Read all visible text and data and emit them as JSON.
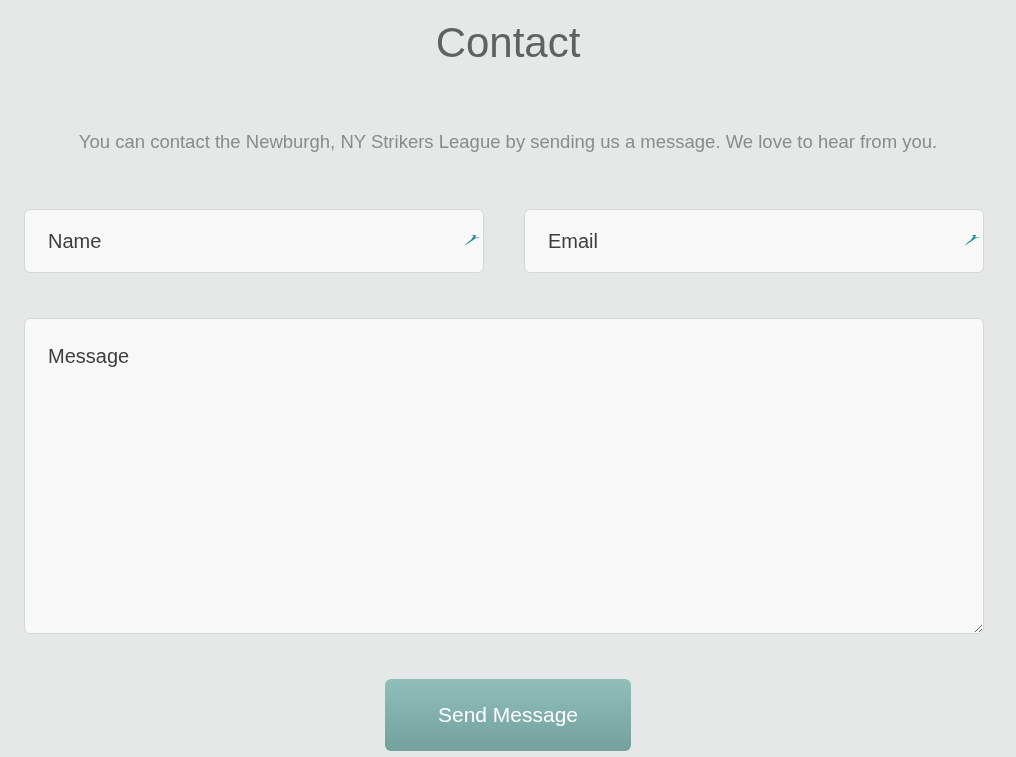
{
  "page": {
    "title": "Contact",
    "intro": "You can contact the Newburgh, NY Strikers League by sending us a message. We love to hear from you."
  },
  "form": {
    "fields": [
      {
        "kind": "text",
        "placeholder": "Name"
      },
      {
        "kind": "text",
        "placeholder": "Email"
      },
      {
        "kind": "textarea",
        "placeholder": "Message"
      }
    ],
    "submit": "Send Message"
  }
}
